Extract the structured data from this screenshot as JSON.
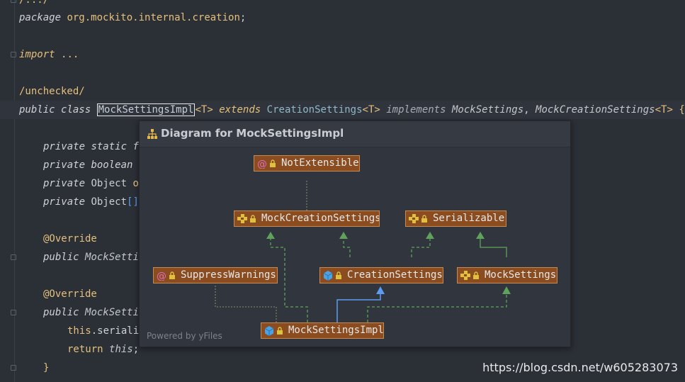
{
  "editor": {
    "line_prev": "/.../",
    "package_kw": "package",
    "package_name": "org.mockito.internal.creation",
    "package_semicolon": ";",
    "import_kw": "import",
    "import_dots": "...",
    "unchecked_comment": "/unchecked/",
    "class_decl": {
      "public_kw": "public",
      "class_kw": "class",
      "class_name": "MockSettingsImpl",
      "generic": "<T>",
      "extends_kw": "extends",
      "parent": "CreationSettings",
      "parent_generic": "<T>",
      "implements_kw": "implements",
      "iface1": "MockSettings",
      "comma": ",",
      "iface2": "MockCreationSettings",
      "iface2_generic": "<T>",
      "brace": "{"
    },
    "fields": [
      {
        "mod": "private",
        "rest_kw": "static",
        "tail": "f"
      },
      {
        "mod": "private",
        "rest_kw": "boolean",
        "tail": ""
      },
      {
        "mod": "private",
        "rest_kw": "Object",
        "tail": "o"
      },
      {
        "mod": "private",
        "rest_kw": "Object",
        "tail": "[]"
      }
    ],
    "override1": "@Override",
    "method1": {
      "public_kw": "public",
      "sig": "MockSetti"
    },
    "override2": "@Override",
    "method2": {
      "public_kw": "public",
      "sig": "MockSetti"
    },
    "body_line1": {
      "this_kw": "this",
      "rest": ".seriali"
    },
    "body_line2": {
      "return_kw": "return",
      "this_kw": "this",
      "semi": ";"
    },
    "close_brace": "}"
  },
  "popup": {
    "title": "Diagram for MockSettingsImpl",
    "powered_by": "Powered by yFiles",
    "nodes": {
      "not_extensible": {
        "label": "NotExtensible",
        "kind": "annotation-icon"
      },
      "mock_creation_settings": {
        "label": "MockCreationSettings",
        "kind": "interface-icon"
      },
      "serializable": {
        "label": "Serializable",
        "kind": "interface-icon"
      },
      "suppress_warnings": {
        "label": "SuppressWarnings",
        "kind": "annotation-icon"
      },
      "creation_settings": {
        "label": "CreationSettings",
        "kind": "class-icon"
      },
      "mock_settings": {
        "label": "MockSettings",
        "kind": "interface-icon"
      },
      "mock_settings_impl": {
        "label": "MockSettingsImpl",
        "kind": "class-icon"
      }
    }
  },
  "watermark": "https://blog.csdn.net/w605283073",
  "colors": {
    "editor_bg": "#2b2f36",
    "node_fill": "#8b4c1f",
    "node_border": "#c58b53",
    "edge_green": "#5fa35a",
    "edge_blue": "#5b9bf1",
    "edge_dotted": "#8b8f70"
  }
}
